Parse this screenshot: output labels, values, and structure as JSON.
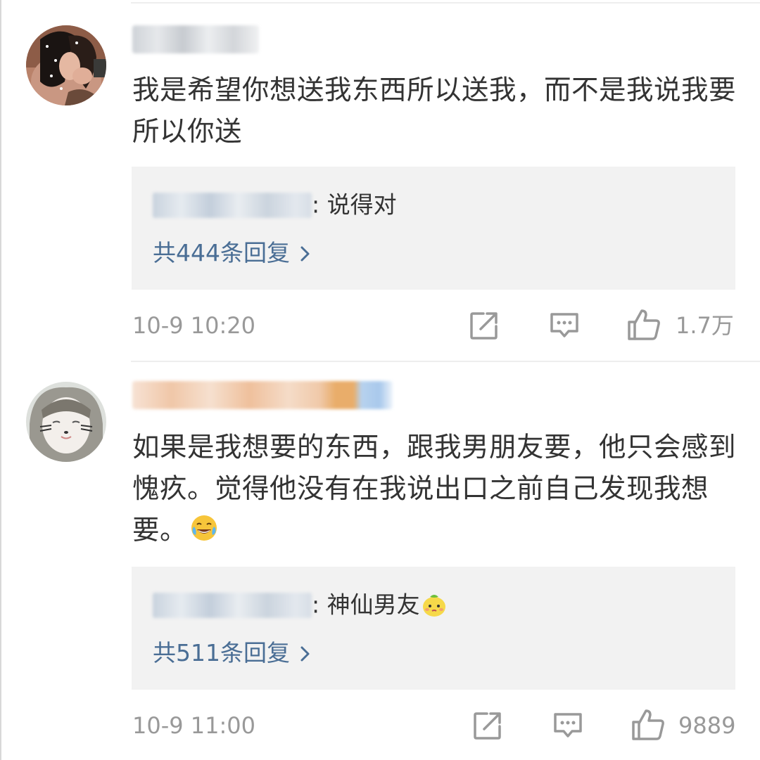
{
  "comments": [
    {
      "text": "我是希望你想送我东西所以送我，而不是我说我要所以你送",
      "reply_preview": {
        "suffix": ": 说得对",
        "more_label": "共444条回复"
      },
      "time": "10-9 10:20",
      "likes": "1.7万"
    },
    {
      "text": "如果是我想要的东西，跟我男朋友要，他只会感到愧疚。觉得他没有在我说出口之前自己发现我想要。",
      "text_emoji": "laughing-tears-emoji",
      "reply_preview": {
        "suffix": ": 神仙男友",
        "emoji": "lemon-emoji",
        "more_label": "共511条回复"
      },
      "time": "10-9 11:00",
      "likes": "9889"
    }
  ],
  "icons": {
    "repost": "repost-icon",
    "comment": "comment-icon",
    "like": "thumbs-up-icon",
    "chevron": "chevron-right-icon"
  },
  "colors": {
    "text": "#333333",
    "meta": "#999999",
    "link": "#4a6e95",
    "reply_bg": "#f2f2f2"
  }
}
